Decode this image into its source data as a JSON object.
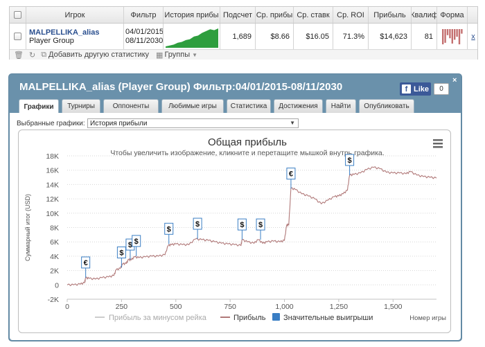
{
  "stats_table": {
    "headers": {
      "player": "Игрок",
      "filter": "Фильтр",
      "profit_history": "История прибы",
      "count": "Подсчет",
      "avg_profit": "Ср. прибы",
      "avg_stake": "Ср. ставк",
      "avg_roi": "Ср. ROI",
      "profit": "Прибыль",
      "qualify": "Квалиф",
      "form": "Форма"
    },
    "row": {
      "player_name": "MALPELLIKA_alias",
      "player_group": "Player Group",
      "filter_from": "04/01/2015",
      "filter_to": "08/11/2030",
      "count": "1,689",
      "avg_profit": "$8.66",
      "avg_stake": "$16.05",
      "avg_roi": "71.3%",
      "profit": "$14,623",
      "qualify": "81",
      "remove": "x"
    },
    "footer": {
      "add_stats": "Добавить другую статистику",
      "groups": "Группы"
    }
  },
  "panel": {
    "title": "MALPELLIKA_alias (Player Group) Фильтр:04/01/2015-08/11/2030",
    "facebook_like": "Like",
    "facebook_f": "f",
    "like_count": "0",
    "close": "×",
    "tabs": [
      {
        "label": "Графики",
        "active": true
      },
      {
        "label": "Турниры",
        "active": false
      },
      {
        "label": "Оппоненты",
        "active": false
      },
      {
        "label": "Любимые игры",
        "active": false
      },
      {
        "label": "Статистика",
        "active": false
      },
      {
        "label": "Достижения",
        "active": false
      },
      {
        "label": "Найти",
        "active": false
      },
      {
        "label": "Опубликовать",
        "active": false
      }
    ],
    "graph_select_label": "Выбранные графики:",
    "graph_select_value": "История прибыли"
  },
  "chart_data": {
    "type": "line",
    "title": "Общая прибыль",
    "subtitle": "Чтобы увеличить изображение, кликните и перетащите мышкой внутрь графика.",
    "xlabel": "Номер игры",
    "ylabel": "Суммарный итог (USD)",
    "xlim": [
      0,
      1700
    ],
    "ylim": [
      -2000,
      18000
    ],
    "x_ticks": [
      "0",
      "250",
      "500",
      "750",
      "1,000",
      "1,250",
      "1,500"
    ],
    "y_ticks": [
      "-2K",
      "0",
      "2K",
      "4K",
      "6K",
      "8K",
      "10K",
      "12K",
      "14K",
      "16K",
      "18K"
    ],
    "grid": true,
    "legend_position": "bottom-center",
    "legend": [
      {
        "name": "Прибыль за минусом рейка",
        "color": "#cccccc",
        "kind": "line"
      },
      {
        "name": "Прибыль",
        "color": "#b07878",
        "kind": "line"
      },
      {
        "name": "Значительные выигрыши",
        "color": "#3a7ec4",
        "kind": "box"
      }
    ],
    "series": [
      {
        "name": "Прибыль",
        "color": "#b07878",
        "points": [
          [
            0,
            0
          ],
          [
            30,
            0
          ],
          [
            60,
            100
          ],
          [
            80,
            300
          ],
          [
            85,
            1000
          ],
          [
            100,
            900
          ],
          [
            130,
            800
          ],
          [
            160,
            1000
          ],
          [
            190,
            1100
          ],
          [
            215,
            1300
          ],
          [
            225,
            2100
          ],
          [
            245,
            2300
          ],
          [
            255,
            2900
          ],
          [
            272,
            3000
          ],
          [
            282,
            3500
          ],
          [
            295,
            3500
          ],
          [
            310,
            3900
          ],
          [
            330,
            3800
          ],
          [
            360,
            3900
          ],
          [
            390,
            4000
          ],
          [
            420,
            4000
          ],
          [
            450,
            4200
          ],
          [
            465,
            5500
          ],
          [
            480,
            5600
          ],
          [
            500,
            5700
          ],
          [
            530,
            5600
          ],
          [
            560,
            5600
          ],
          [
            590,
            6400
          ],
          [
            620,
            6300
          ],
          [
            650,
            6200
          ],
          [
            680,
            6000
          ],
          [
            710,
            5800
          ],
          [
            740,
            5700
          ],
          [
            770,
            5600
          ],
          [
            800,
            5500
          ],
          [
            805,
            6300
          ],
          [
            830,
            6000
          ],
          [
            860,
            5800
          ],
          [
            880,
            6300
          ],
          [
            900,
            5800
          ],
          [
            920,
            6000
          ],
          [
            950,
            6100
          ],
          [
            980,
            6000
          ],
          [
            1000,
            6200
          ],
          [
            1010,
            8300
          ],
          [
            1020,
            8400
          ],
          [
            1030,
            13500
          ],
          [
            1050,
            13300
          ],
          [
            1080,
            12700
          ],
          [
            1110,
            12400
          ],
          [
            1140,
            12000
          ],
          [
            1170,
            11300
          ],
          [
            1200,
            11800
          ],
          [
            1230,
            12300
          ],
          [
            1250,
            12400
          ],
          [
            1270,
            12700
          ],
          [
            1290,
            13200
          ],
          [
            1300,
            15300
          ],
          [
            1320,
            15400
          ],
          [
            1350,
            15600
          ],
          [
            1380,
            16100
          ],
          [
            1410,
            16400
          ],
          [
            1440,
            16200
          ],
          [
            1470,
            15700
          ],
          [
            1500,
            15600
          ],
          [
            1530,
            15600
          ],
          [
            1560,
            15500
          ],
          [
            1580,
            15800
          ],
          [
            1610,
            15300
          ],
          [
            1640,
            15100
          ],
          [
            1670,
            15000
          ],
          [
            1700,
            14900
          ]
        ]
      }
    ],
    "flags": [
      {
        "x": 85,
        "y": 1000,
        "symbol": "€"
      },
      {
        "x": 250,
        "y": 2400,
        "symbol": "$"
      },
      {
        "x": 290,
        "y": 3500,
        "symbol": "$"
      },
      {
        "x": 318,
        "y": 4000,
        "symbol": "$"
      },
      {
        "x": 468,
        "y": 5700,
        "symbol": "$"
      },
      {
        "x": 600,
        "y": 6400,
        "symbol": "$"
      },
      {
        "x": 805,
        "y": 6300,
        "symbol": "$"
      },
      {
        "x": 890,
        "y": 6300,
        "symbol": "$"
      },
      {
        "x": 1030,
        "y": 13400,
        "symbol": "€"
      },
      {
        "x": 1300,
        "y": 15300,
        "symbol": "$"
      }
    ]
  },
  "mini_chart": {
    "label": "profit-history-sparkline",
    "color": "#2e9e3e",
    "values": [
      0,
      0.05,
      0.1,
      0.2,
      0.25,
      0.35,
      0.4,
      0.55,
      0.6,
      0.75,
      0.85,
      0.95,
      0.9,
      1.0
    ]
  },
  "form_bars": {
    "color": "#c47070",
    "values": [
      1,
      0.9,
      0.4,
      0.6,
      0.95,
      0.7,
      0.5,
      1.0,
      0.3
    ]
  }
}
